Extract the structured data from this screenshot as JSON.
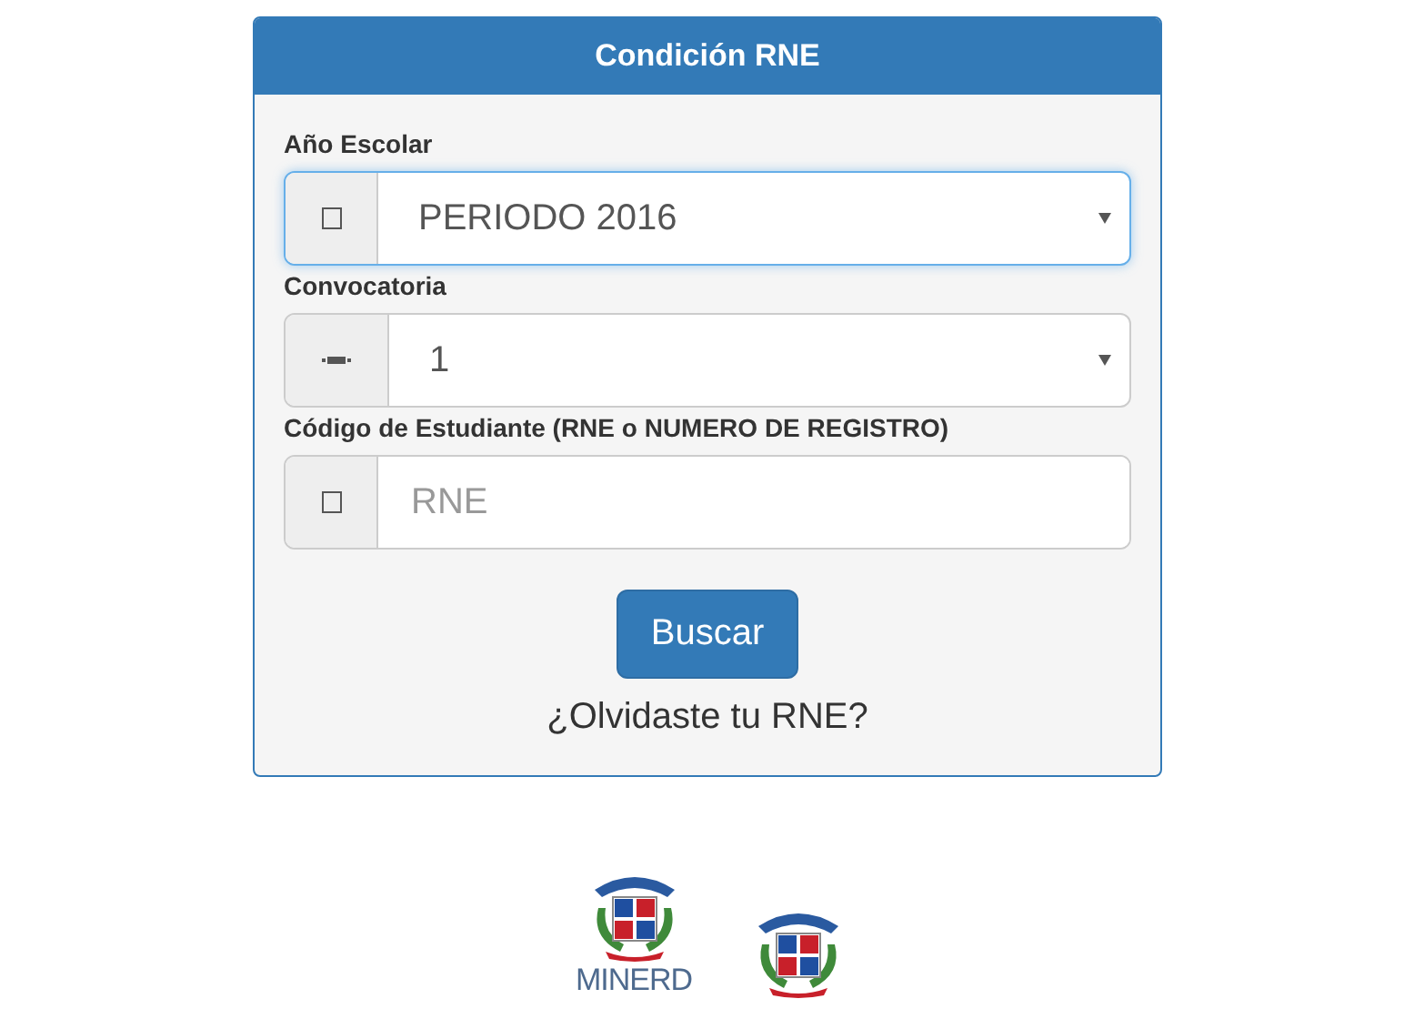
{
  "panel": {
    "title": "Condición RNE"
  },
  "fields": [
    {
      "label": "Año Escolar",
      "kind": "select",
      "value": "PERIODO 2016",
      "focused": true
    },
    {
      "label": "Convocatoria",
      "kind": "select",
      "value": "1",
      "focused": false
    },
    {
      "label": "Código de Estudiante (RNE o NUMERO DE REGISTRO)",
      "kind": "text",
      "placeholder": "RNE",
      "focused": false
    }
  ],
  "button": "Buscar",
  "link": "¿Olvidaste tu RNE?",
  "footer": {
    "logo_text": "MINERD"
  }
}
